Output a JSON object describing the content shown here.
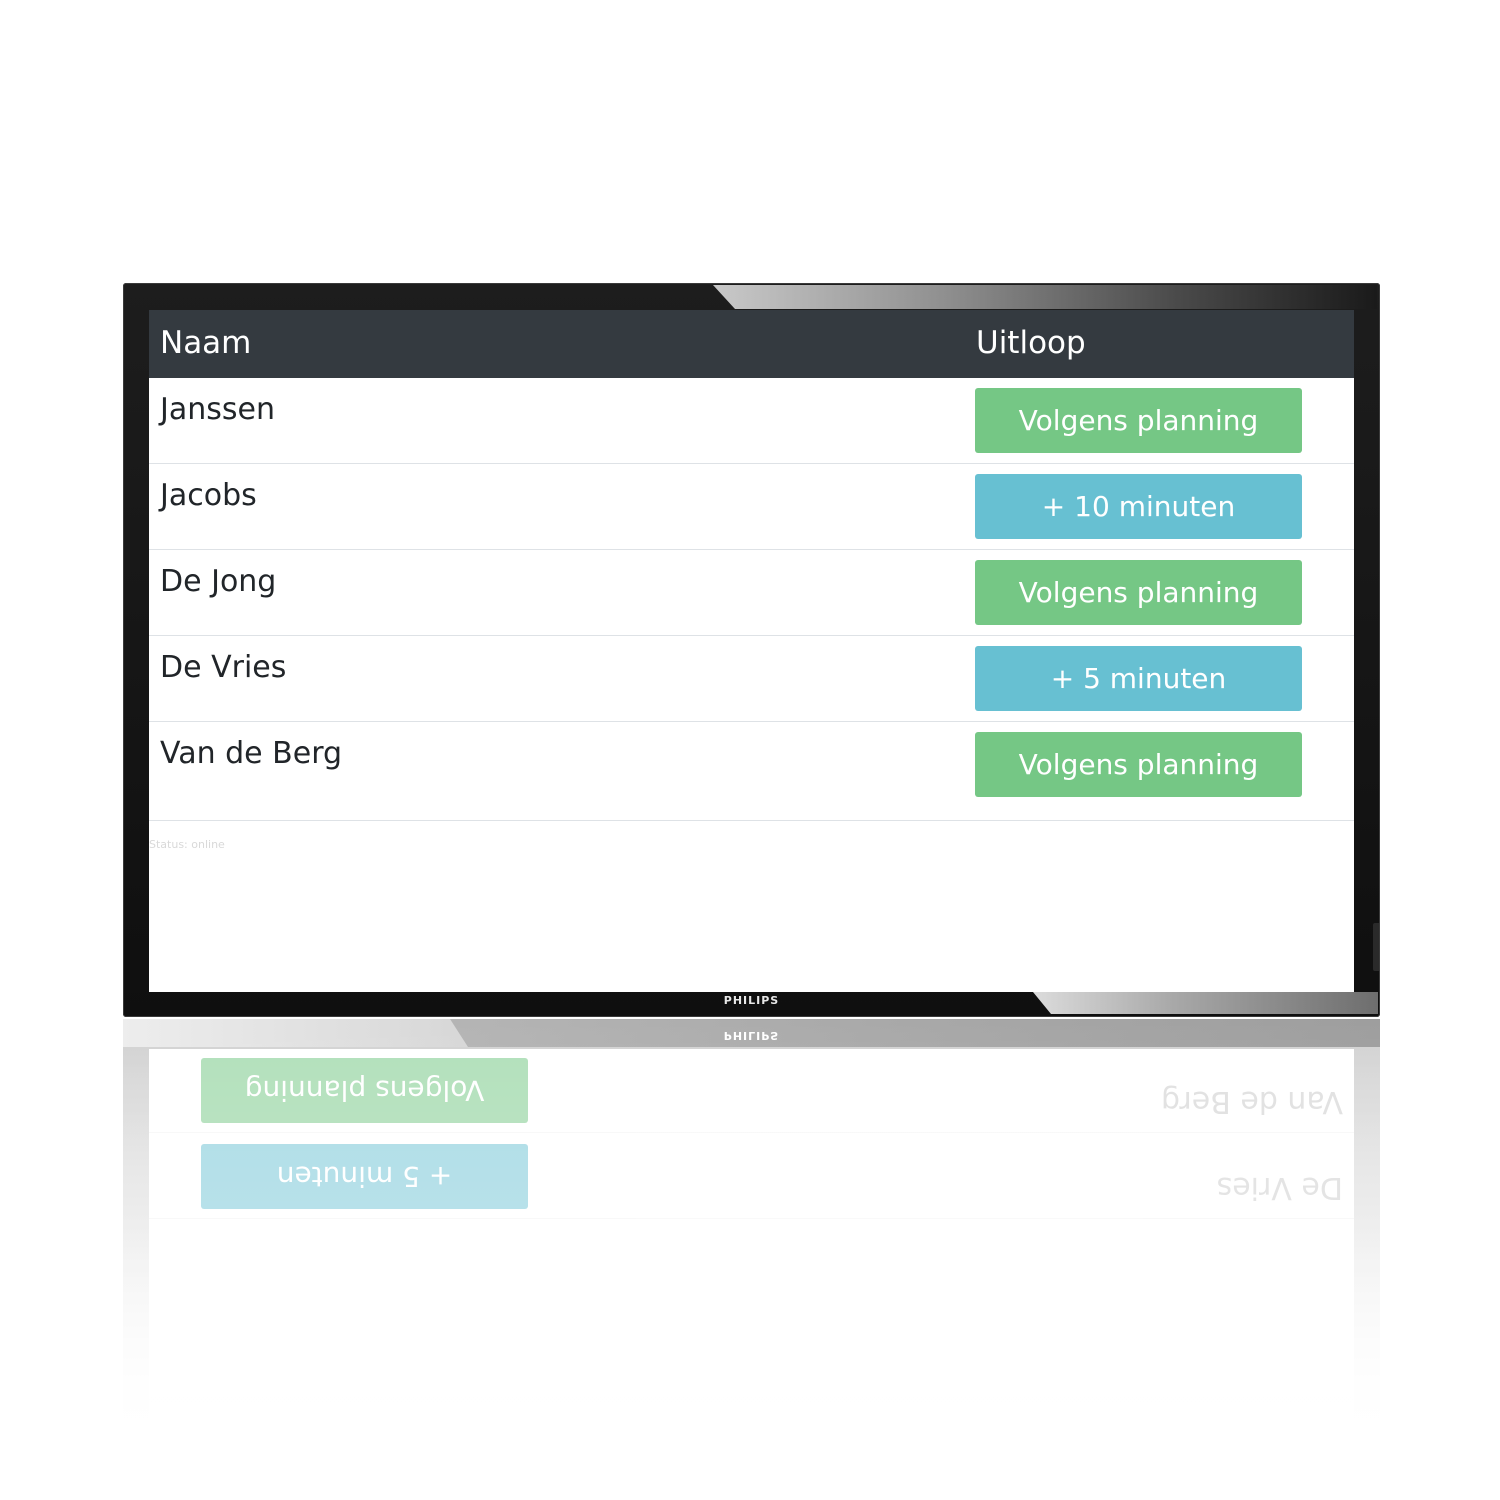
{
  "monitor": {
    "brand": "PHILIPS"
  },
  "table": {
    "headers": {
      "name": "Naam",
      "delay": "Uitloop"
    },
    "rows": [
      {
        "name": "Janssen",
        "delay": "Volgens planning",
        "status": "on-time"
      },
      {
        "name": "Jacobs",
        "delay": "+ 10 minuten",
        "status": "delayed"
      },
      {
        "name": "De Jong",
        "delay": "Volgens planning",
        "status": "on-time"
      },
      {
        "name": "De Vries",
        "delay": "+ 5 minuten",
        "status": "delayed"
      },
      {
        "name": "Van de Berg",
        "delay": "Volgens planning",
        "status": "on-time"
      }
    ]
  },
  "status_text": "Status: online",
  "colors": {
    "header_bg": "#343a40",
    "on_time": "#75c785",
    "delayed": "#67c0d2",
    "row_border": "#dee2e6"
  }
}
